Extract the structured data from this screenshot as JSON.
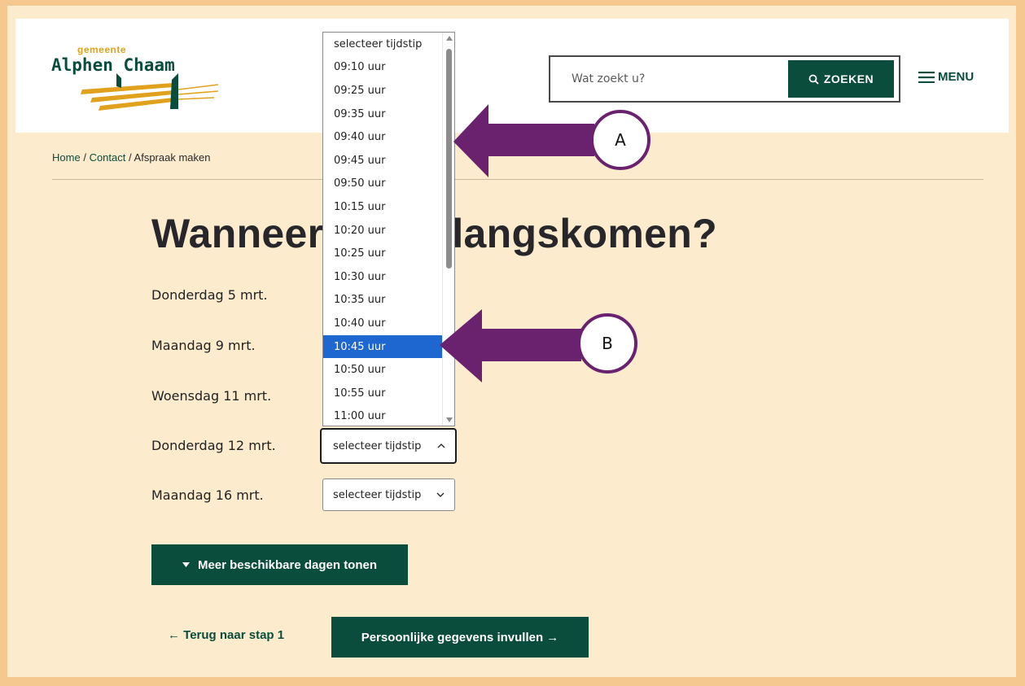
{
  "header": {
    "logo_small": "gemeente",
    "logo_name": "Alphen Chaam",
    "search_placeholder": "Wat zoekt u?",
    "search_button": "ZOEKEN",
    "menu_label": "MENU"
  },
  "breadcrumb": {
    "home": "Home",
    "sep1": "/",
    "contact": "Contact",
    "sep2": "/",
    "current": "Afspraak maken"
  },
  "page_title": "Wanneer wilt u langskomen?",
  "days": [
    {
      "label": "Donderdag 5 mrt."
    },
    {
      "label": "Maandag 9 mrt."
    },
    {
      "label": "Woensdag 11 mrt."
    },
    {
      "label": "Donderdag 12 mrt.",
      "select_value": "selecteer tijdstip"
    },
    {
      "label": "Maandag 16 mrt.",
      "select_value": "selecteer tijdstip"
    }
  ],
  "dropdown": {
    "options": [
      "selecteer tijdstip",
      "09:10 uur",
      "09:25 uur",
      "09:35 uur",
      "09:40 uur",
      "09:45 uur",
      "09:50 uur",
      "10:15 uur",
      "10:20 uur",
      "10:25 uur",
      "10:30 uur",
      "10:35 uur",
      "10:40 uur",
      "10:45 uur",
      "10:50 uur",
      "10:55 uur",
      "11:00 uur"
    ],
    "selected_index": 13
  },
  "buttons": {
    "more_days": "Meer beschikbare dagen tonen",
    "back": "← Terug naar stap 1",
    "next": "Persoonlijke gegevens invullen →"
  },
  "annotations": {
    "a_label": "A",
    "b_label": "B",
    "arrow_color": "#6a226f"
  },
  "colors": {
    "brand_green": "#0a4d3c",
    "page_bg": "#fcebcc",
    "border_frame": "#f5c88f",
    "logo_gold": "#e0a21c",
    "selected_option": "#1e66d0"
  }
}
